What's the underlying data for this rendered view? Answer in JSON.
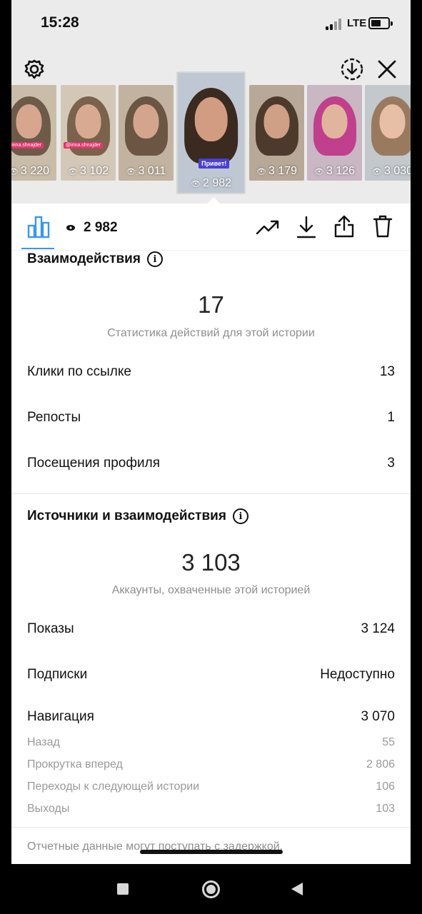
{
  "status_bar": {
    "time": "15:28",
    "network": "LTE",
    "battery_level": 0.6
  },
  "stories": [
    {
      "views": "3 220",
      "tag": "@irina.shnajder",
      "colors": [
        "#c9bca9",
        "#d7a68e",
        "#6e5a48"
      ]
    },
    {
      "views": "3 102",
      "tag": "@irina.shnajder",
      "colors": [
        "#d3c8b8",
        "#d9aa92",
        "#7a624d"
      ]
    },
    {
      "views": "3 011",
      "tag": "",
      "colors": [
        "#c2b3a0",
        "#d4a58c",
        "#6b5644"
      ]
    },
    {
      "views": "2 982",
      "sticker": "Привет!",
      "current": true,
      "colors": [
        "#bfc8d2",
        "#d19c82",
        "#3a2a20"
      ]
    },
    {
      "views": "3 179",
      "tag": "",
      "colors": [
        "#b8a897",
        "#cf9f86",
        "#4d3a2c"
      ]
    },
    {
      "views": "3 126",
      "tag": "",
      "colors": [
        "#c9b7c4",
        "#e1b59d",
        "#c0408d"
      ]
    },
    {
      "views": "3 030",
      "tag": "",
      "colors": [
        "#c2c8cc",
        "#e6bfa6",
        "#9a7a5e"
      ]
    }
  ],
  "toolbar": {
    "views": "2 982"
  },
  "interactions": {
    "title": "Взаимодействия",
    "total": "17",
    "caption": "Статистика действий для этой истории",
    "rows": [
      {
        "label": "Клики по ссылке",
        "value": "13"
      },
      {
        "label": "Репосты",
        "value": "1"
      },
      {
        "label": "Посещения профиля",
        "value": "3"
      }
    ]
  },
  "discovery": {
    "title": "Источники и взаимодействия",
    "total": "3 103",
    "caption": "Аккаунты, охваченные этой историей",
    "rows": [
      {
        "label": "Показы",
        "value": "3 124"
      },
      {
        "label": "Подписки",
        "value": "Недоступно"
      }
    ],
    "navigation": {
      "label": "Навигация",
      "value": "3 070",
      "items": [
        {
          "label": "Назад",
          "value": "55"
        },
        {
          "label": "Прокрутка вперед",
          "value": "2 806"
        },
        {
          "label": "Переходы к следующей истории",
          "value": "106"
        },
        {
          "label": "Выходы",
          "value": "103"
        }
      ]
    }
  },
  "footer_note": "Отчетные данные могут поступать с задержкой.",
  "colors": {
    "accent": "#3897f0",
    "text": "#111111",
    "muted": "#8e8e8e",
    "header_bg": "#ebebeb"
  }
}
